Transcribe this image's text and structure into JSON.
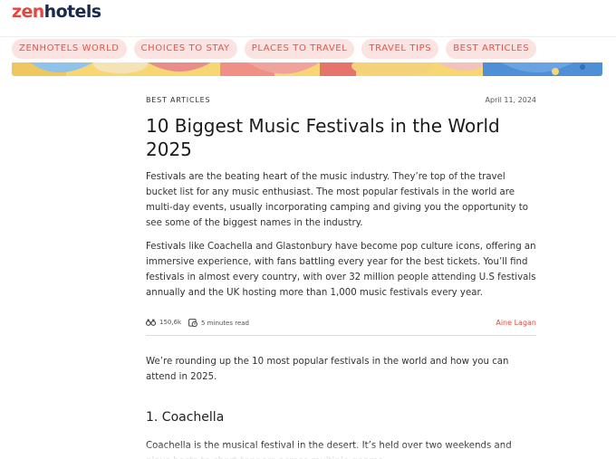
{
  "brand": {
    "logo_zen": "zen",
    "logo_hotels": "hotels"
  },
  "nav": {
    "items": [
      "ZENHOTELS WORLD",
      "CHOICES TO STAY",
      "PLACES TO TRAVEL",
      "TRAVEL TIPS",
      "BEST ARTICLES"
    ]
  },
  "colors": {
    "accent": "#e5463d",
    "pill_bg": "#fbe3e1",
    "brand_navy": "#1a2a4f"
  },
  "article": {
    "category": "BEST ARTICLES",
    "date": "April 11, 2024",
    "title": "10 Biggest Music Festivals in the World 2025",
    "intro": [
      "Festivals are the beating heart of the music industry. They’re top of the travel bucket list for any music enthusiast. The most popular festivals in the world are multi-day events, usually incorporating camping and giving you the opportunity to see some of the biggest names in the industry.",
      "Festivals like Coachella and Glastonbury have become pop culture icons, offering an immersive experience, with fans battling every year for the best tickets. You’ll find festivals in almost every country, with over 32 million people attending U.S festivals annually and the UK hosting more than 1,000 music festivals every year."
    ],
    "views": "150,6k",
    "read_time": "5 minutes read",
    "author": "Aine Lagan",
    "lead": "We’re rounding up the 10 most popular festivals in the world and how you can attend in 2025.",
    "section_title": "1. Coachella",
    "section_body": "Coachella is the musical festival in the desert. It’s held over two weekends and plays hosts to chart-toppers across multiple genres."
  },
  "icons": {
    "views": "binoculars-icon",
    "read_time": "clock-book-icon"
  }
}
